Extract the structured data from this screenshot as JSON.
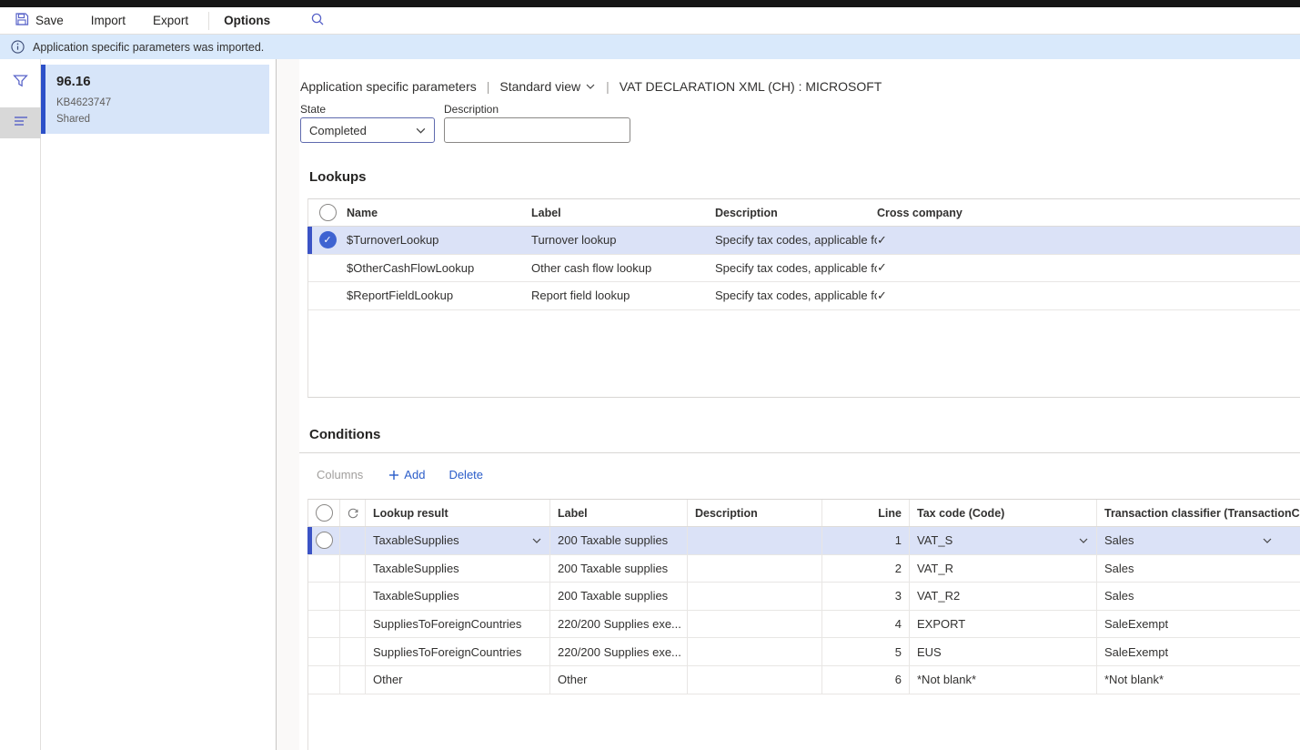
{
  "toolbar": {
    "save": "Save",
    "import": "Import",
    "export": "Export",
    "options": "Options"
  },
  "notification": {
    "text": "Application specific parameters was imported."
  },
  "sidebar": {
    "selected_item": {
      "version": "96.16",
      "kb": "KB4623747",
      "scope": "Shared"
    }
  },
  "header": {
    "title": "Application specific parameters",
    "separator": "|",
    "view": "Standard view",
    "subtitle": "VAT DECLARATION XML (CH) : MICROSOFT"
  },
  "fields": {
    "state_label": "State",
    "state_value": "Completed",
    "description_label": "Description",
    "description_value": ""
  },
  "lookups": {
    "heading": "Lookups",
    "columns": {
      "name": "Name",
      "label": "Label",
      "description": "Description",
      "cross": "Cross company"
    },
    "rows": [
      {
        "name": "$TurnoverLookup",
        "label": "Turnover lookup",
        "description": "Specify tax codes, applicable for...",
        "cross_company": true
      },
      {
        "name": "$OtherCashFlowLookup",
        "label": "Other cash flow lookup",
        "description": "Specify tax codes, applicable for...",
        "cross_company": true
      },
      {
        "name": "$ReportFieldLookup",
        "label": "Report field lookup",
        "description": "Specify tax codes, applicable for...",
        "cross_company": true
      }
    ]
  },
  "conditions": {
    "heading": "Conditions",
    "toolbar": {
      "columns": "Columns",
      "add": "Add",
      "delete": "Delete"
    },
    "columns": {
      "lookup_result": "Lookup result",
      "label": "Label",
      "description": "Description",
      "line": "Line",
      "tax_code": "Tax code (Code)",
      "classifier": "Transaction classifier (TransactionCla..."
    },
    "rows": [
      {
        "lookup_result": "TaxableSupplies",
        "label": "200 Taxable supplies",
        "description": "",
        "line": "1",
        "tax_code": "VAT_S",
        "classifier": "Sales"
      },
      {
        "lookup_result": "TaxableSupplies",
        "label": "200 Taxable supplies",
        "description": "",
        "line": "2",
        "tax_code": "VAT_R",
        "classifier": "Sales"
      },
      {
        "lookup_result": "TaxableSupplies",
        "label": "200 Taxable supplies",
        "description": "",
        "line": "3",
        "tax_code": "VAT_R2",
        "classifier": "Sales"
      },
      {
        "lookup_result": "SuppliesToForeignCountries",
        "label": "220/200 Supplies exe...",
        "description": "",
        "line": "4",
        "tax_code": "EXPORT",
        "classifier": "SaleExempt"
      },
      {
        "lookup_result": "SuppliesToForeignCountries",
        "label": "220/200 Supplies exe...",
        "description": "",
        "line": "5",
        "tax_code": "EUS",
        "classifier": "SaleExempt"
      },
      {
        "lookup_result": "Other",
        "label": "Other",
        "description": "",
        "line": "6",
        "tax_code": "*Not blank*",
        "classifier": "*Not blank*"
      }
    ]
  },
  "icons": {
    "check": "✓"
  },
  "colors": {
    "accent_icon": "#5661c8",
    "link_blue": "#2b5dc9",
    "selection_bg": "#dbe2f7",
    "selection_accent": "#3b53c5",
    "list_item_bg": "#d7e5f9",
    "list_item_accent": "#2c50c8",
    "notification_bg": "#d9e9fb",
    "topbar_bg": "#161616"
  }
}
